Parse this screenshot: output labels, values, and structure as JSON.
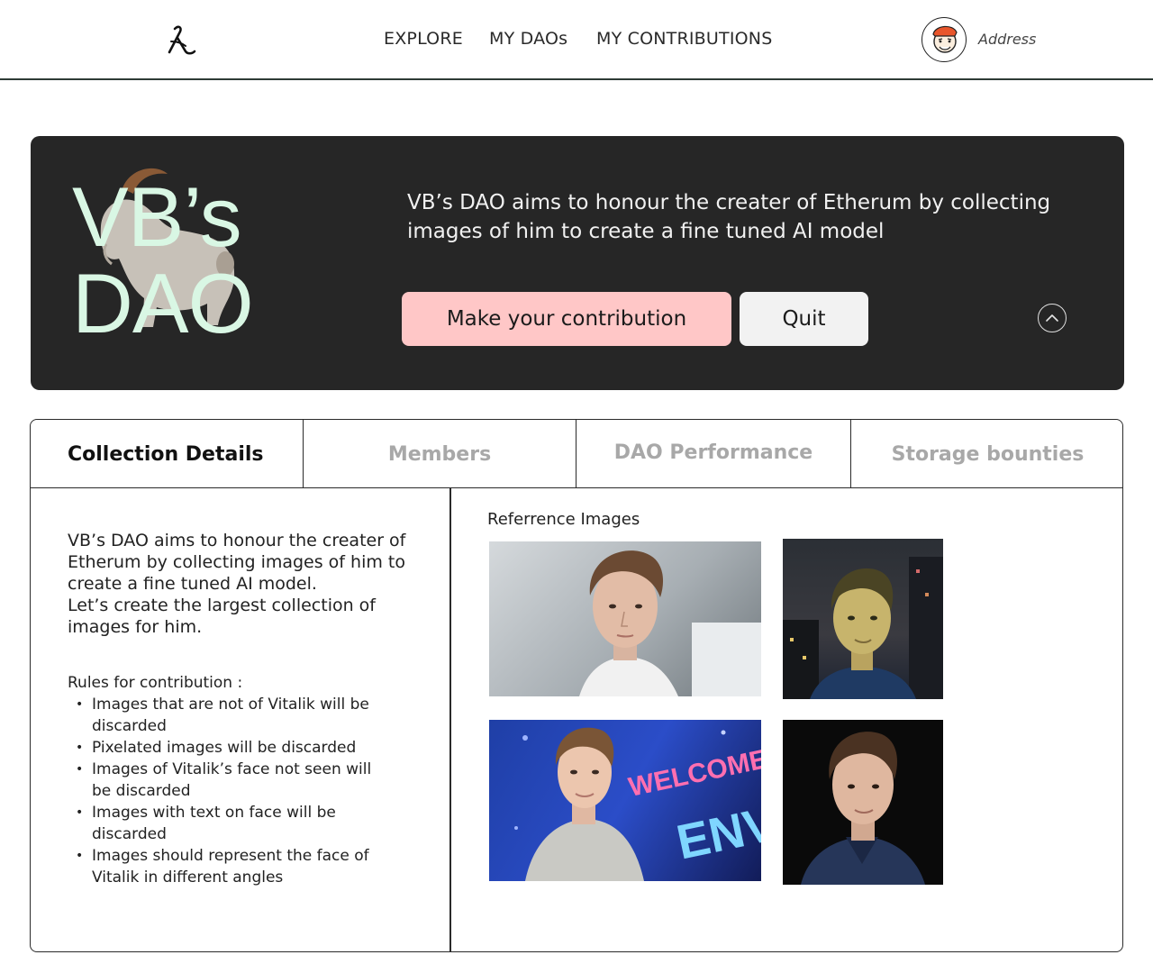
{
  "header": {
    "nav": {
      "explore": "EXPLORE",
      "my_daos": "MY DAOs",
      "my_contributions": "MY CONTRIBUTIONS"
    },
    "address_label": "Address"
  },
  "hero": {
    "title_line1": "VB’s",
    "title_line2": "DAO",
    "description": "VB’s DAO aims to honour the creater of Etherum by collecting images of him to create a fine tuned AI model",
    "contribute_label": "Make your contribution",
    "quit_label": "Quit",
    "colors": {
      "background": "#262626",
      "title": "#d9f7e4",
      "contribute_button": "#ffc7c7",
      "quit_button": "#f2f2f2"
    },
    "icons": [
      "goat-illustration",
      "chevron-up-icon"
    ]
  },
  "tabs": [
    {
      "label": "Collection Details",
      "active": true
    },
    {
      "label": "Members",
      "active": false
    },
    {
      "label": "DAO Performance",
      "active": false
    },
    {
      "label": "Storage bounties",
      "active": false
    }
  ],
  "collection": {
    "about_line1": "VB’s DAO aims to honour the creater of Etherum by collecting images of him to create a fine tuned AI model.",
    "about_line2": "Let’s create the largest collection of images for him.",
    "rules_title": "Rules for contribution :",
    "rules": [
      "Images that are not of Vitalik will be discarded",
      "Pixelated images will be discarded",
      "Images of Vitalik’s face not seen will be discarded",
      "Images with text on face will be discarded",
      "Images should represent the face of Vitalik in different angles"
    ],
    "reference_title": "Referrence Images",
    "photo3_banner_text": "WELCOME TO",
    "photo3_banner_text2": "ENV"
  }
}
